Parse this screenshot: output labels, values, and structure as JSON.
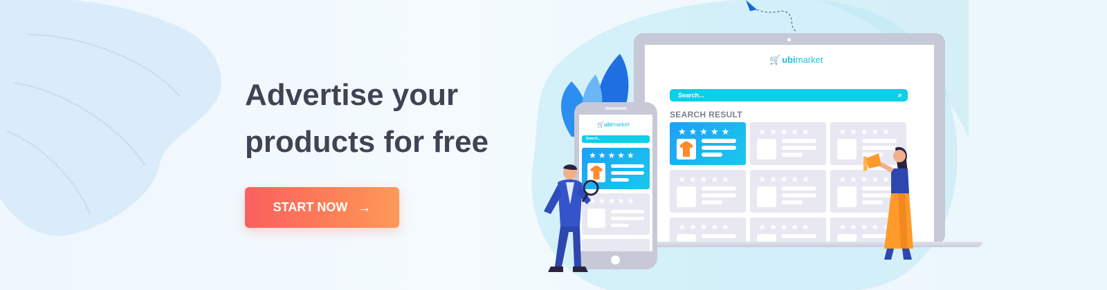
{
  "hero": {
    "headline_line1": "Advertise your",
    "headline_line2": "products for free",
    "cta_label": "START NOW"
  },
  "laptop_screen": {
    "logo_prefix": "ubi",
    "logo_suffix": "market",
    "search_placeholder": "Search...",
    "section_title": "SEARCH RESULT",
    "rating_stars": "★★★★★"
  },
  "phone_screen": {
    "logo_prefix": "ubi",
    "logo_suffix": "market",
    "search_placeholder": "Search...",
    "rating_stars": "★★★★★"
  },
  "icons": {
    "cta_arrow": "arrow-right-icon",
    "search": "search-icon",
    "cart": "cart-icon",
    "megaphone": "megaphone-icon",
    "magnifier": "magnifying-glass-icon"
  },
  "colors": {
    "headline": "#414355",
    "cta_start": "#fb5f5f",
    "cta_end": "#fd9a57",
    "brand_cyan": "#0ccfe8",
    "active_card": "#1fa0f5"
  }
}
